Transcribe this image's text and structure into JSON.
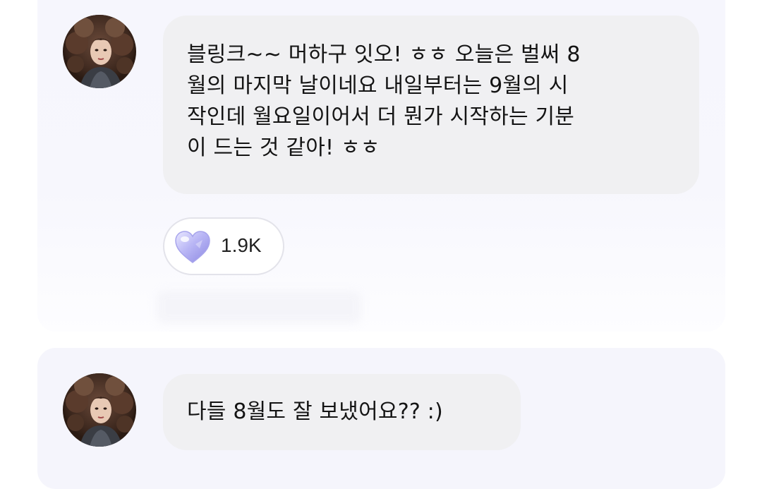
{
  "feed": {
    "posts": [
      {
        "message_lines": [
          "블링크~~ 머하구 잇오! ㅎㅎ 오늘은 벌써 8",
          "월의 마지막 날이네요 내일부터는 9월의 시",
          "작인데 월요일이어서 더 뭔가 시작하는 기분",
          "이 드는 것 같아! ㅎㅎ"
        ],
        "reaction": {
          "icon": "heart-icon",
          "count": "1.9K"
        }
      },
      {
        "message_lines": [
          "다들 8월도 잘 보냈어요?? :)"
        ]
      }
    ]
  },
  "colors": {
    "card_background": "#f6f6fd",
    "bubble_background": "#f0f0f2",
    "text": "#141414",
    "heart": "#c6c4ff"
  }
}
